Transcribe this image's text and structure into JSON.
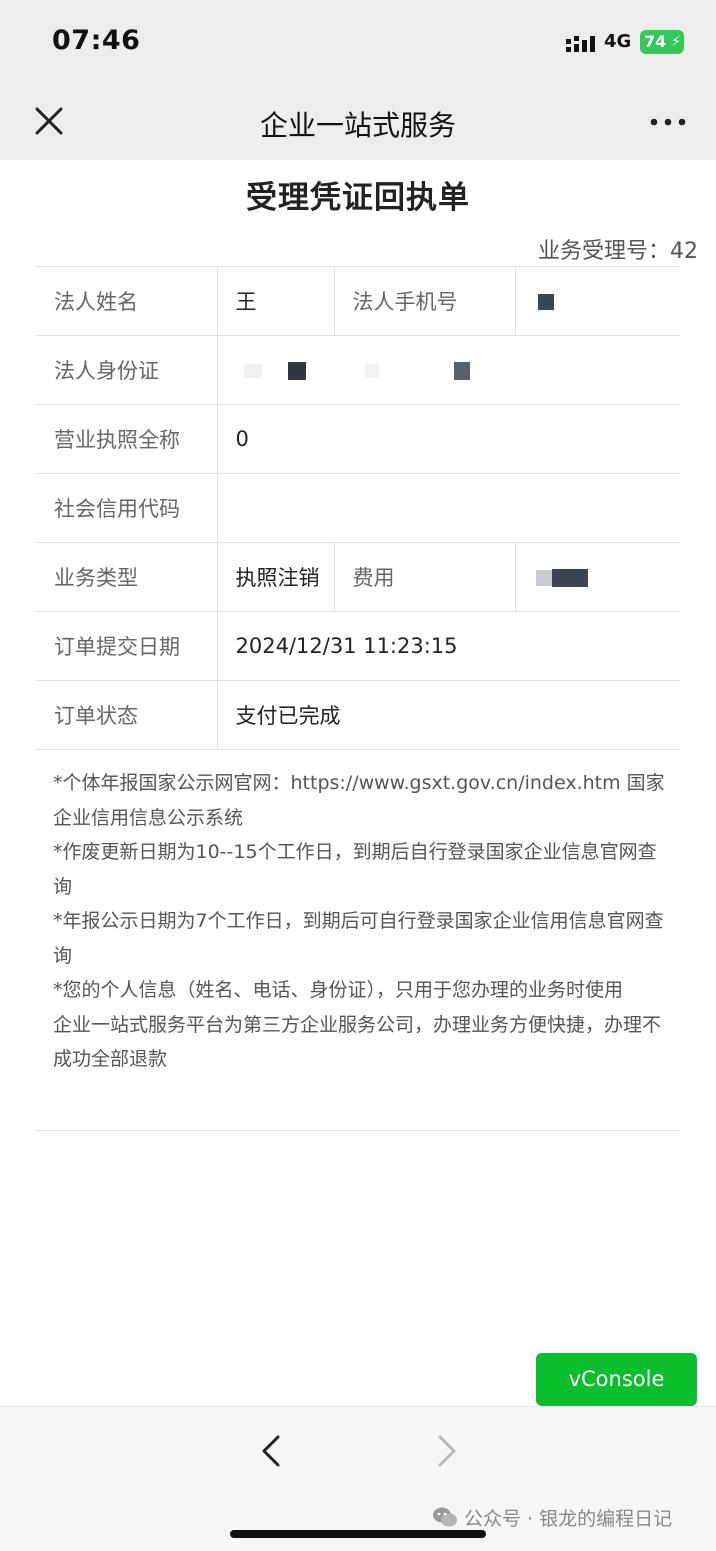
{
  "status_bar": {
    "time": "07:46",
    "network": "4G",
    "battery": "74"
  },
  "nav": {
    "title": "企业一站式服务"
  },
  "document": {
    "title": "受理凭证回执单",
    "order_no_label": "业务受理号：42"
  },
  "rows": {
    "legal_name_label": "法人姓名",
    "legal_name_value": "王",
    "legal_phone_label": "法人手机号",
    "legal_id_label": "法人身份证",
    "license_name_label": "营业执照全称",
    "license_name_value": "0",
    "credit_code_label": "社会信用代码",
    "business_type_label": "业务类型",
    "business_type_value": "执照注销",
    "fee_label": "费用",
    "submit_date_label": "订单提交日期",
    "submit_date_value": "2024/12/31 11:23:15",
    "order_status_label": "订单状态",
    "order_status_value": "支付已完成"
  },
  "notes": [
    "*个体年报国家公示网官网：https://www.gsxt.gov.cn/index.htm 国家企业信用信息公示系统",
    "*作废更新日期为10--15个工作日，到期后自行登录国家企业信息官网查询",
    "*年报公示日期为7个工作日，到期后可自行登录国家企业信用信息官网查询",
    "*您的个人信息（姓名、电话、身份证），只用于您办理的业务时使用",
    "企业一站式服务平台为第三方企业服务公司，办理业务方便快捷，办理不成功全部退款"
  ],
  "vconsole_label": "vConsole",
  "watermark": "公众号 · 银龙的编程日记",
  "colors": {
    "bar_bg": "#ededed",
    "vconsole_green": "#0bbe2e",
    "battery_green": "#34c759"
  }
}
